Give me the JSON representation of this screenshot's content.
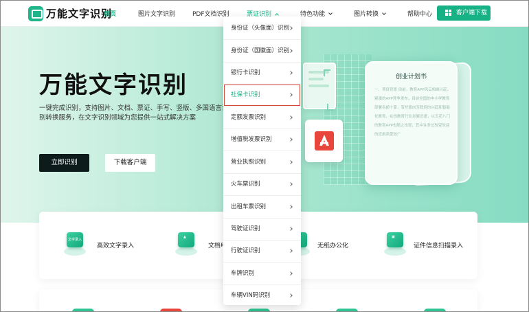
{
  "brand": {
    "name": "万能文字识别"
  },
  "nav": {
    "home": "首页",
    "image_ocr": "图片文字识别",
    "pdf_ocr": "PDF文档识别",
    "ticket_ocr": "票证识别",
    "features": "特色功能",
    "image_convert": "图片转换",
    "help": "帮助中心",
    "download": "客户端下载"
  },
  "hero": {
    "title": "万能文字识别",
    "description": "一键完成识别，支持图片、文档、票证、手写、竖版、多国语言识别转换服务，在文字识别领域为您提供一站式解决方案",
    "primary_button": "立即识别",
    "secondary_button": "下载客户端"
  },
  "illustration": {
    "doc_title": "创业计划书",
    "doc_body": "一、项目背景 目前，教育APP风云相继兴起，紧凑的APP竞争发布，目前全国的中小学教育部署名超十家，有些面向互联网的兴起和智能化教育，在线教育行业发展迅速，以五花八门的教育APP也随之出现，其中许多比较受欢迎的应用类型较广"
  },
  "features": [
    {
      "label": "高效文字录入",
      "icon": "text-input-icon",
      "icon_text": "文字录入"
    },
    {
      "label": "文档电",
      "icon": "pdf-doc-icon"
    },
    {
      "label": "无纸办公化",
      "icon": "paperless-icon"
    },
    {
      "label": "证件信息扫描录入",
      "icon": "id-card-scan-icon"
    }
  ],
  "dropdown": {
    "items": [
      "身份证（头像面）识别",
      "身份证（国徽面）识别",
      "银行卡识别",
      "社保卡识别",
      "定额发票识别",
      "增值税发票识别",
      "营业执照识别",
      "火车票识别",
      "出租车票识别",
      "驾驶证识别",
      "行驶证识别",
      "车牌识别",
      "车辆VIN码识别"
    ],
    "selected_index": 3
  },
  "colors": {
    "accent": "#16b184",
    "highlight_border": "#d9473b",
    "pdf_red": "#e8453c",
    "bottom_dots": [
      "#2ec493",
      "#e8453c",
      "#2ec493",
      "#2ec493",
      "#2ec493"
    ]
  }
}
